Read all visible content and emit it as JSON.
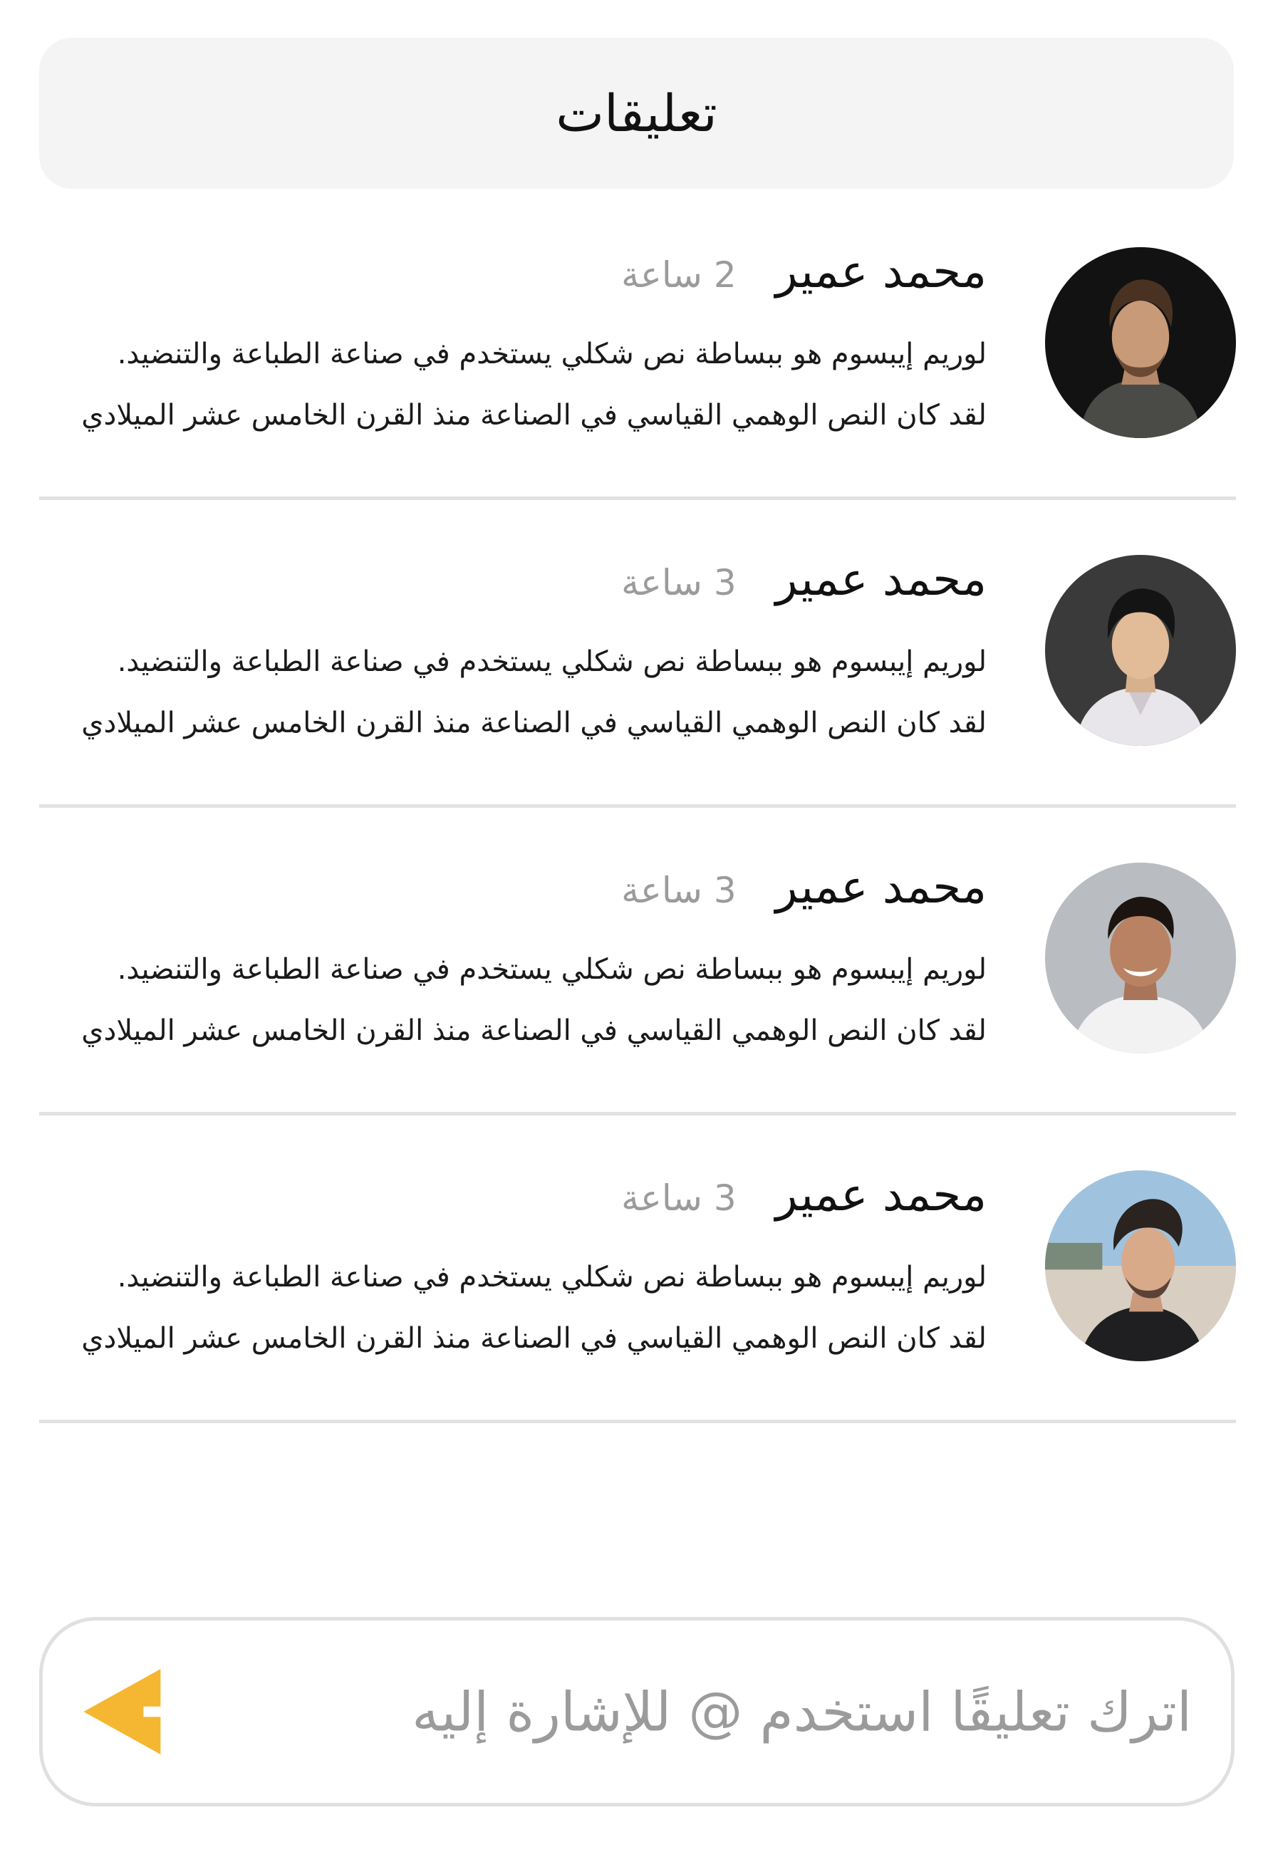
{
  "header": {
    "title": "تعليقات"
  },
  "comments": [
    {
      "author": "محمد عمير",
      "time": "2 ساعة",
      "line1": "لوريم إيبسوم هو ببساطة نص شكلي يستخدم في صناعة الطباعة والتنضيد.",
      "line2": "لقد كان النص الوهمي القياسي في الصناعة منذ القرن الخامس عشر الميلادي"
    },
    {
      "author": "محمد عمير",
      "time": "3 ساعة",
      "line1": "لوريم إيبسوم هو ببساطة نص شكلي يستخدم في صناعة الطباعة والتنضيد.",
      "line2": "لقد كان النص الوهمي القياسي في الصناعة منذ القرن الخامس عشر الميلادي"
    },
    {
      "author": "محمد عمير",
      "time": "3 ساعة",
      "line1": "لوريم إيبسوم هو ببساطة نص شكلي يستخدم في صناعة الطباعة والتنضيد.",
      "line2": "لقد كان النص الوهمي القياسي في الصناعة منذ القرن الخامس عشر الميلادي"
    },
    {
      "author": "محمد عمير",
      "time": "3 ساعة",
      "line1": "لوريم إيبسوم هو ببساطة نص شكلي يستخدم في صناعة الطباعة والتنضيد.",
      "line2": "لقد كان النص الوهمي القياسي في الصناعة منذ القرن الخامس عشر الميلادي"
    }
  ],
  "input": {
    "placeholder": "اترك تعليقًا استخدم @ للإشارة إليه",
    "value": ""
  },
  "send_icon": "send-arrow-icon",
  "colors": {
    "accent": "#f5b731",
    "header_bg": "#f4f4f4",
    "muted_text": "#9b9b9b",
    "divider": "#e2e2e2"
  }
}
